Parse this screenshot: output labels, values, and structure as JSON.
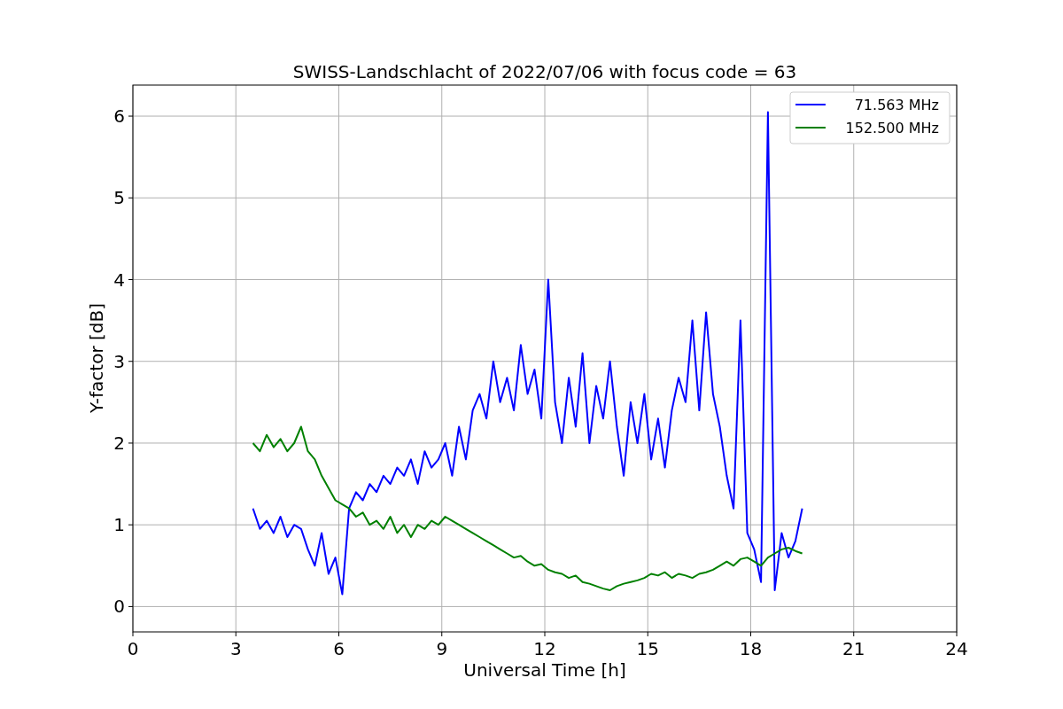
{
  "chart_data": {
    "type": "line",
    "title": "SWISS-Landschlacht of 2022/07/06 with focus code = 63",
    "xlabel": "Universal Time [h]",
    "ylabel": "Y-factor [dB]",
    "x": [
      3.5,
      3.7,
      3.9,
      4.1,
      4.3,
      4.5,
      4.7,
      4.9,
      5.1,
      5.3,
      5.5,
      5.7,
      5.9,
      6.1,
      6.3,
      6.5,
      6.7,
      6.9,
      7.1,
      7.3,
      7.5,
      7.7,
      7.9,
      8.1,
      8.3,
      8.5,
      8.7,
      8.9,
      9.1,
      9.3,
      9.5,
      9.7,
      9.9,
      10.1,
      10.3,
      10.5,
      10.7,
      10.9,
      11.1,
      11.3,
      11.5,
      11.7,
      11.9,
      12.1,
      12.3,
      12.5,
      12.7,
      12.9,
      13.1,
      13.3,
      13.5,
      13.7,
      13.9,
      14.1,
      14.3,
      14.5,
      14.7,
      14.9,
      15.1,
      15.3,
      15.5,
      15.7,
      15.9,
      16.1,
      16.3,
      16.5,
      16.7,
      16.9,
      17.1,
      17.3,
      17.5,
      17.7,
      17.9,
      18.1,
      18.3,
      18.5,
      18.7,
      18.9,
      19.1,
      19.3,
      19.5
    ],
    "series": [
      {
        "name": "71.563 MHz",
        "color": "#0000ff",
        "values": [
          1.2,
          0.95,
          1.05,
          0.9,
          1.1,
          0.85,
          1.0,
          0.95,
          0.7,
          0.5,
          0.9,
          0.4,
          0.6,
          0.15,
          1.2,
          1.4,
          1.3,
          1.5,
          1.4,
          1.6,
          1.5,
          1.7,
          1.6,
          1.8,
          1.5,
          1.9,
          1.7,
          1.8,
          2.0,
          1.6,
          2.2,
          1.8,
          2.4,
          2.6,
          2.3,
          3.0,
          2.5,
          2.8,
          2.4,
          3.2,
          2.6,
          2.9,
          2.3,
          4.0,
          2.5,
          2.0,
          2.8,
          2.2,
          3.1,
          2.0,
          2.7,
          2.3,
          3.0,
          2.2,
          1.6,
          2.5,
          2.0,
          2.6,
          1.8,
          2.3,
          1.7,
          2.4,
          2.8,
          2.5,
          3.5,
          2.4,
          3.6,
          2.6,
          2.2,
          1.6,
          1.2,
          3.5,
          0.9,
          0.7,
          0.3,
          6.05,
          0.2,
          0.9,
          0.6,
          0.8,
          1.2
        ]
      },
      {
        "name": "152.500 MHz",
        "color": "#008000",
        "values": [
          2.0,
          1.9,
          2.1,
          1.95,
          2.05,
          1.9,
          2.0,
          2.2,
          1.9,
          1.8,
          1.6,
          1.45,
          1.3,
          1.25,
          1.2,
          1.1,
          1.15,
          1.0,
          1.05,
          0.95,
          1.1,
          0.9,
          1.0,
          0.85,
          1.0,
          0.95,
          1.05,
          1.0,
          1.1,
          1.05,
          1.0,
          0.95,
          0.9,
          0.85,
          0.8,
          0.75,
          0.7,
          0.65,
          0.6,
          0.62,
          0.55,
          0.5,
          0.52,
          0.45,
          0.42,
          0.4,
          0.35,
          0.38,
          0.3,
          0.28,
          0.25,
          0.22,
          0.2,
          0.25,
          0.28,
          0.3,
          0.32,
          0.35,
          0.4,
          0.38,
          0.42,
          0.35,
          0.4,
          0.38,
          0.35,
          0.4,
          0.42,
          0.45,
          0.5,
          0.55,
          0.5,
          0.58,
          0.6,
          0.55,
          0.5,
          0.6,
          0.65,
          0.7,
          0.72,
          0.68,
          0.65
        ]
      }
    ],
    "grid": true,
    "legend": true,
    "xlim": [
      0,
      24
    ],
    "ylim": [
      -0.31,
      6.38
    ],
    "xticks": [
      0,
      3,
      6,
      9,
      12,
      15,
      18,
      21,
      24
    ],
    "yticks": [
      0,
      1,
      2,
      3,
      4,
      5,
      6
    ]
  }
}
